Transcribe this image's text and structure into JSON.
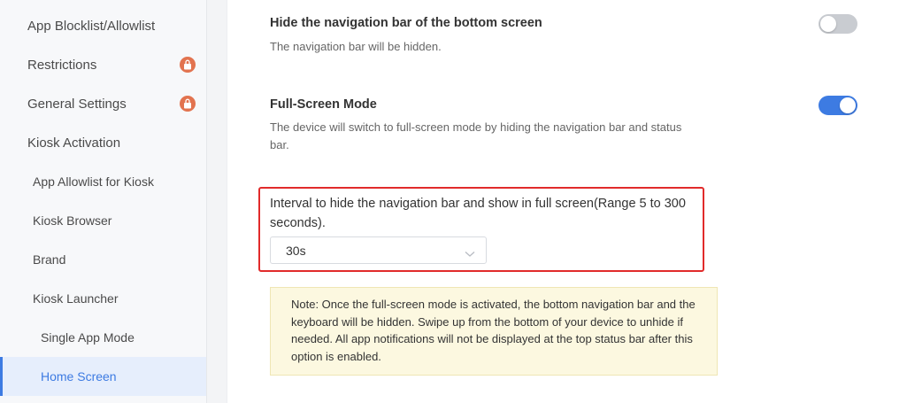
{
  "sidebar": {
    "items": [
      {
        "label": "App Blocklist/Allowlist",
        "level": 1,
        "locked": false,
        "active": false
      },
      {
        "label": "Restrictions",
        "level": 1,
        "locked": true,
        "active": false
      },
      {
        "label": "General Settings",
        "level": 1,
        "locked": true,
        "active": false
      },
      {
        "label": "Kiosk Activation",
        "level": 1,
        "locked": false,
        "active": false
      },
      {
        "label": "App Allowlist for Kiosk",
        "level": 2,
        "locked": false,
        "active": false
      },
      {
        "label": "Kiosk Browser",
        "level": 2,
        "locked": false,
        "active": false
      },
      {
        "label": "Brand",
        "level": 2,
        "locked": false,
        "active": false
      },
      {
        "label": "Kiosk Launcher",
        "level": 2,
        "locked": false,
        "active": false
      },
      {
        "label": "Single App Mode",
        "level": 3,
        "locked": false,
        "active": false
      },
      {
        "label": "Home Screen",
        "level": 3,
        "locked": false,
        "active": true
      }
    ],
    "lock_icon": "lock-icon",
    "lock_color": "#e2734f",
    "active_color": "#3d7be2"
  },
  "settings": {
    "hide_nav": {
      "title": "Hide the navigation bar of the bottom screen",
      "description": "The navigation bar will be hidden.",
      "enabled": false
    },
    "full_screen": {
      "title": "Full-Screen Mode",
      "description": "The device will switch to full-screen mode by hiding the navigation bar and status bar.",
      "enabled": true
    },
    "interval": {
      "label": "Interval to hide the navigation bar and show in full screen(Range 5 to 300 seconds).",
      "selected": "30s",
      "chevron_icon": "chevron-down-icon"
    },
    "note": "Note: Once the full-screen mode is activated, the bottom navigation bar and the keyboard will be hidden. Swipe up from the bottom of your device to unhide if needed. All app notifications will not be displayed at the top status bar after this option is enabled."
  },
  "colors": {
    "toggle_on": "#3d7be2",
    "toggle_off": "#c9ccd1",
    "highlight": "#e12b2b",
    "note_bg": "#fcf8e0"
  }
}
